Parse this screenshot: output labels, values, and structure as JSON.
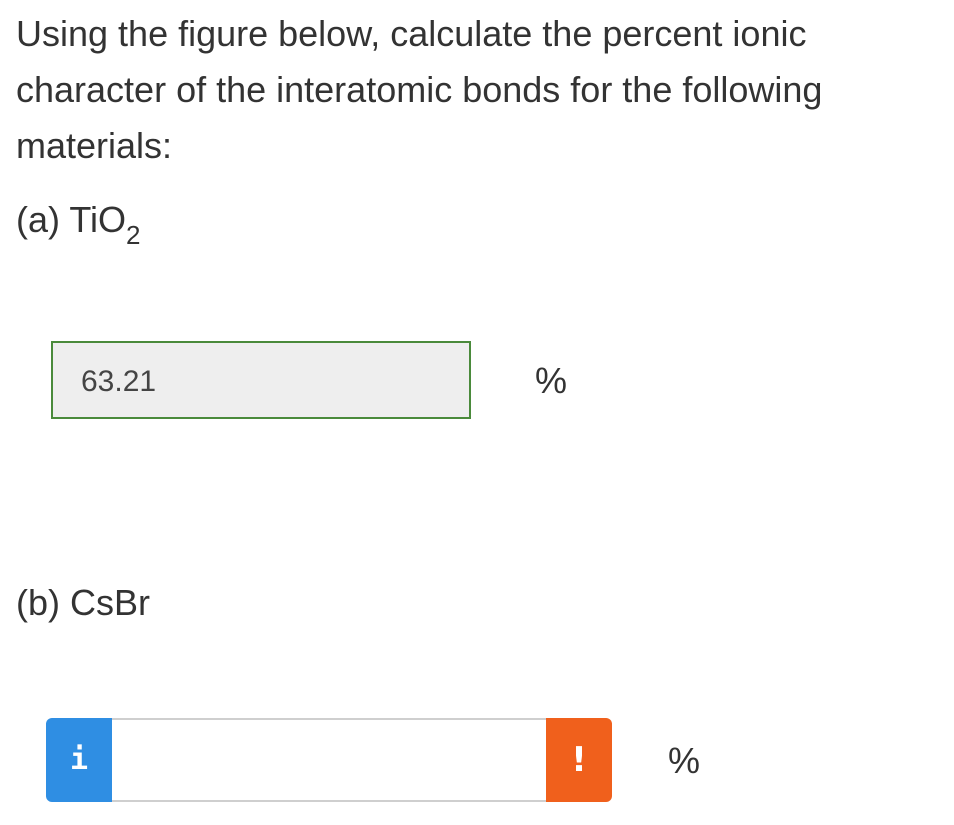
{
  "question": {
    "text": "Using the figure below, calculate the percent ionic character of the interatomic bonds for the following materials:"
  },
  "parts": [
    {
      "prefix": "(a) TiO",
      "subscript": "2",
      "answer_value": "63.21",
      "unit": "%",
      "status_color": "#4a8a3b"
    },
    {
      "prefix": "(b) CsBr",
      "subscript": "",
      "answer_value": "",
      "unit": "%",
      "info_icon": "i",
      "warning_icon": "!",
      "info_color": "#2f8ee3",
      "warning_color": "#f0601c"
    }
  ]
}
